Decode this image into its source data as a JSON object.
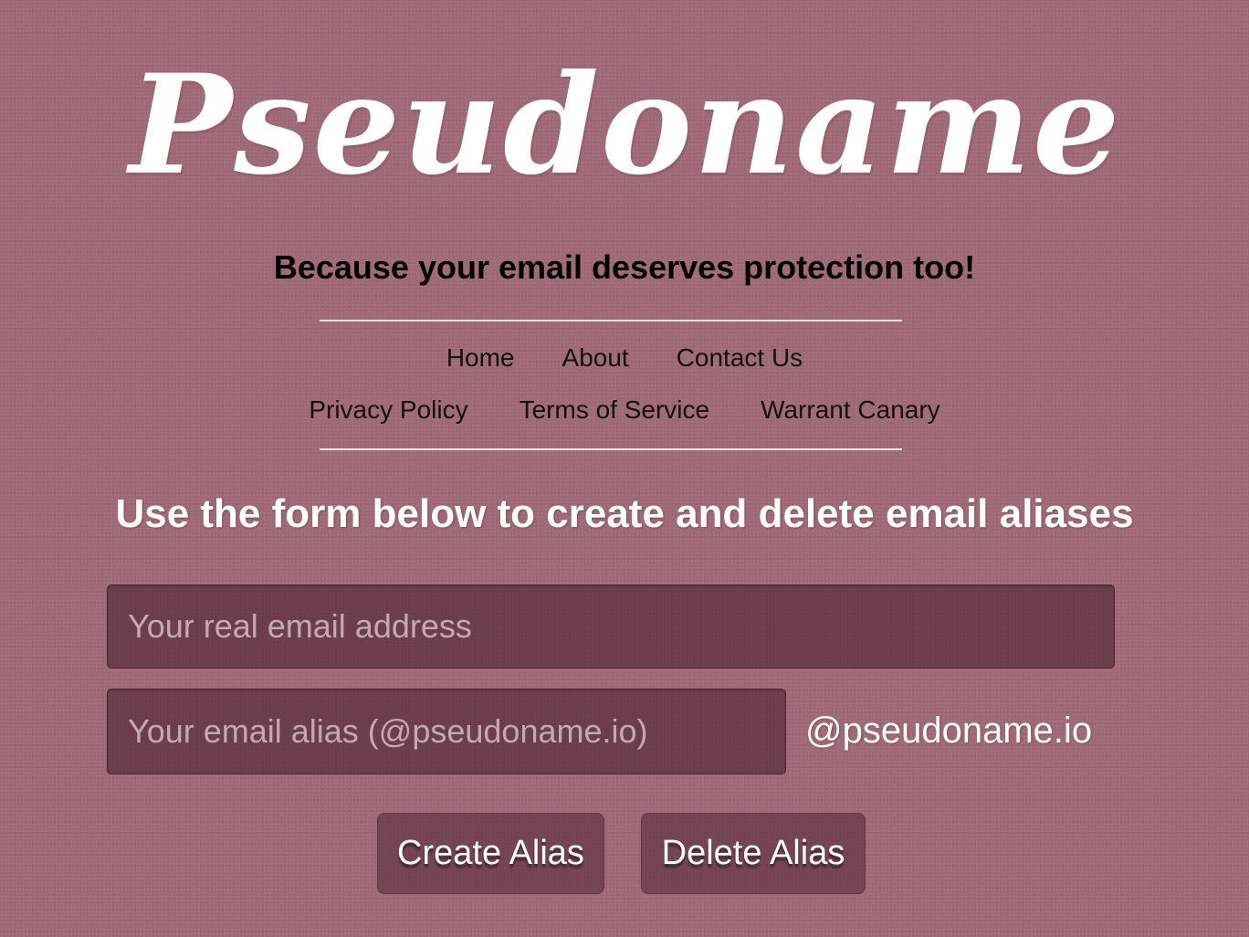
{
  "brand": {
    "logo_text": "Pseudoname",
    "tagline": "Because your email deserves protection too!"
  },
  "nav": {
    "row1": [
      "Home",
      "About",
      "Contact Us"
    ],
    "row2": [
      "Privacy Policy",
      "Terms of Service",
      "Warrant Canary"
    ]
  },
  "main": {
    "headline": "Use the form below to create and delete email aliases",
    "email_field": {
      "placeholder": "Your real email address",
      "value": ""
    },
    "alias_field": {
      "placeholder": "Your email alias (@pseudoname.io)",
      "value": ""
    },
    "domain_suffix": "@pseudoname.io",
    "create_label": "Create Alias",
    "delete_label": "Delete Alias"
  },
  "colors": {
    "background": "#a0697a",
    "text_light": "#ffffff",
    "text_dark": "#000000"
  }
}
